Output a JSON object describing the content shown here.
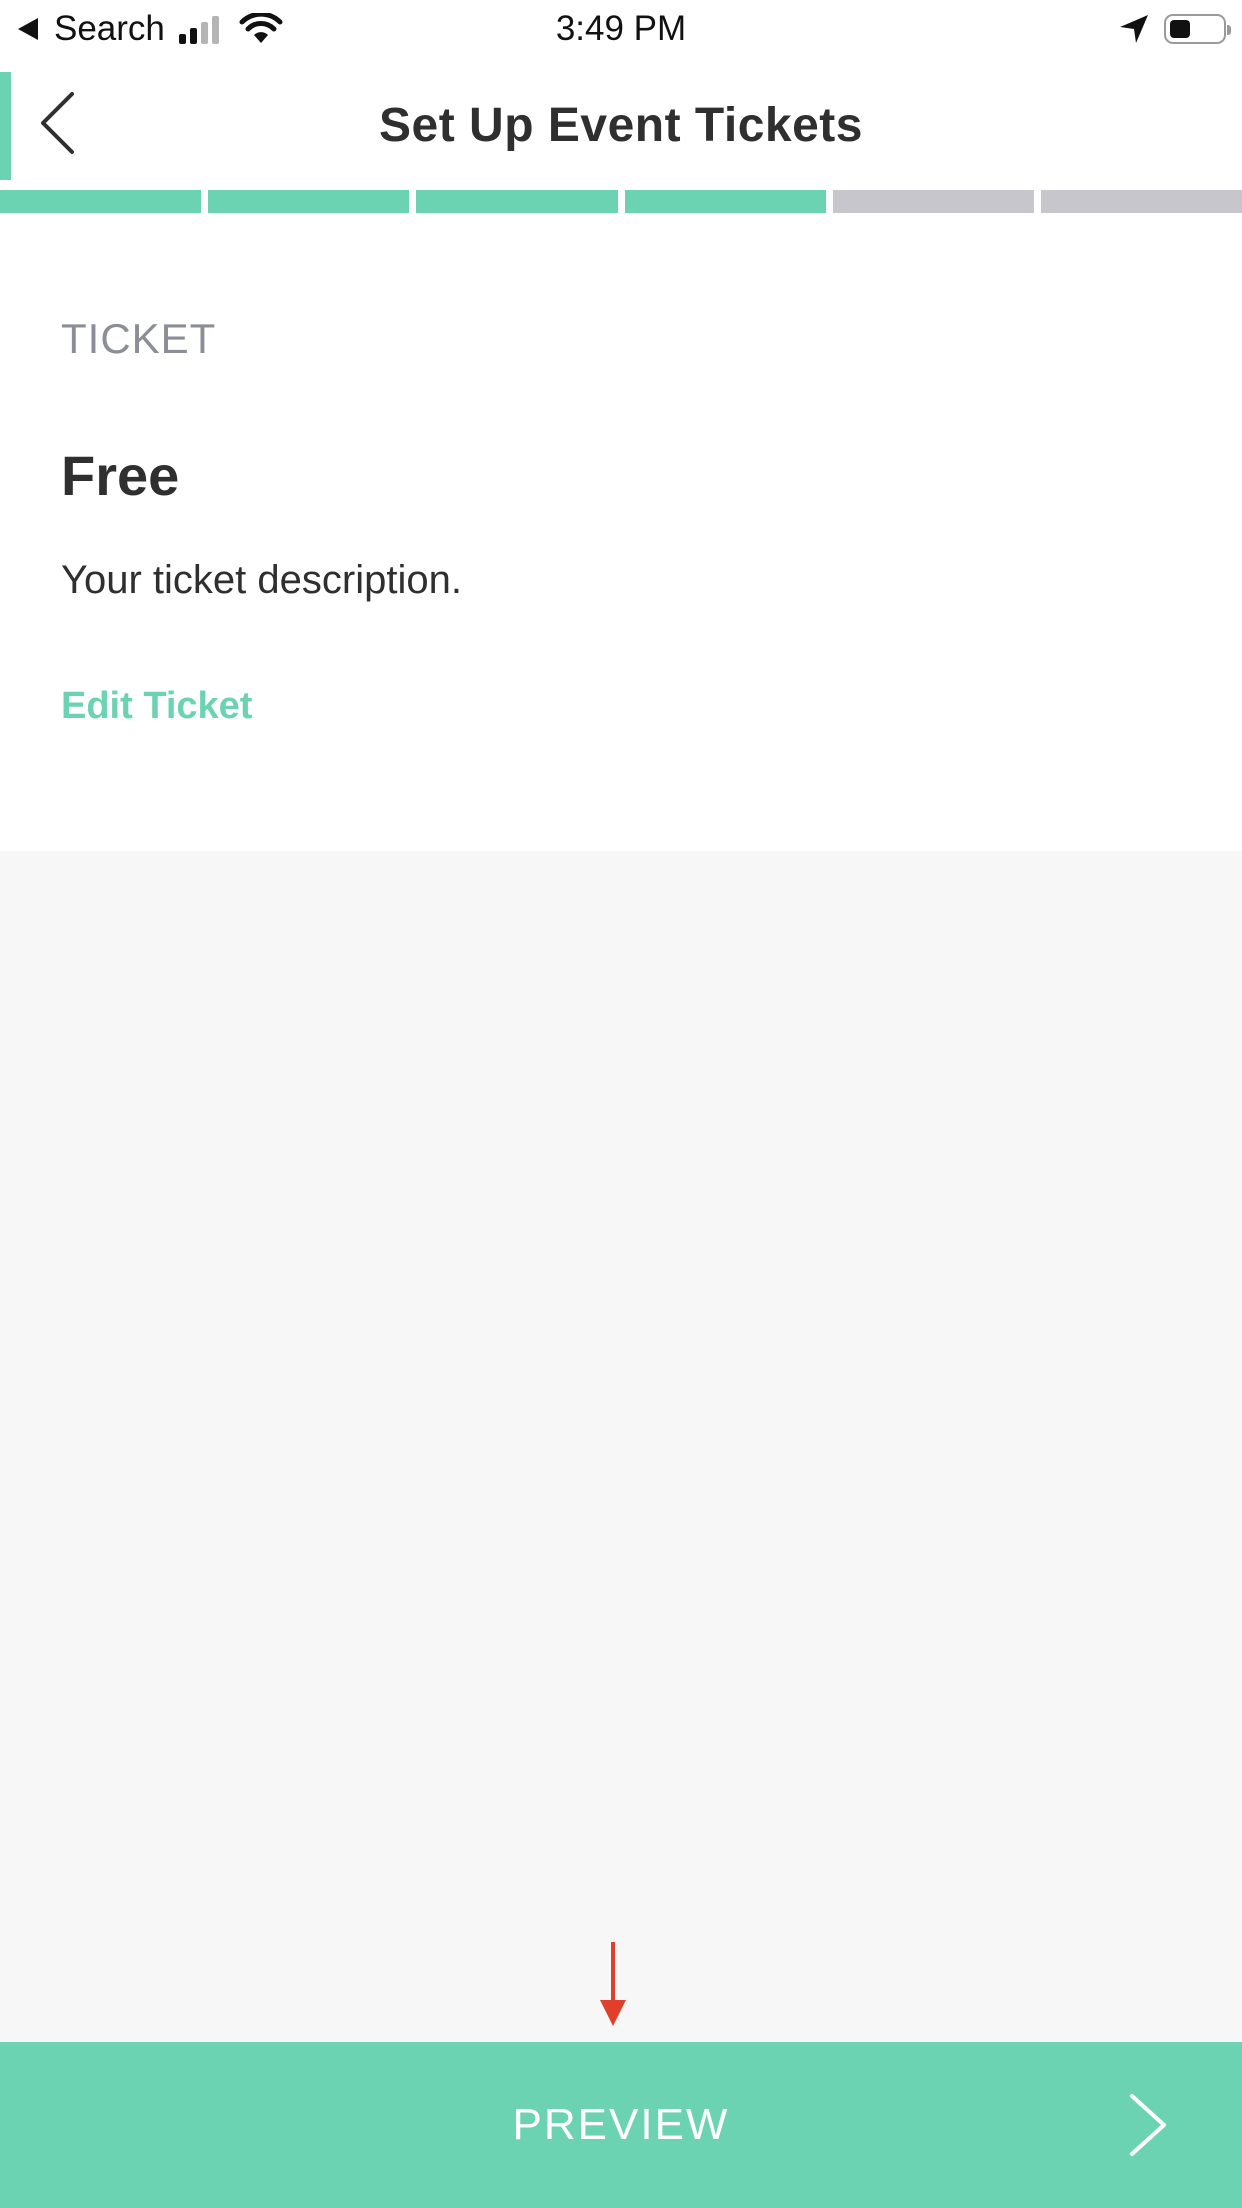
{
  "status_bar": {
    "back_label": "Search",
    "time": "3:49 PM",
    "battery_level": 0.4
  },
  "header": {
    "title": "Set Up Event Tickets"
  },
  "progress": {
    "total_steps": 6,
    "completed_steps": 4,
    "accent_color": "#6cd3b2",
    "inactive_color": "#c6c6cc"
  },
  "ticket": {
    "section_label": "TICKET",
    "name": "Free",
    "description": "Your ticket description.",
    "edit_label": "Edit Ticket"
  },
  "annotation": {
    "color": "#e0402b",
    "icon": "arrow-down-icon"
  },
  "footer": {
    "preview_label": "PREVIEW",
    "icon": "chevron-right-icon"
  }
}
